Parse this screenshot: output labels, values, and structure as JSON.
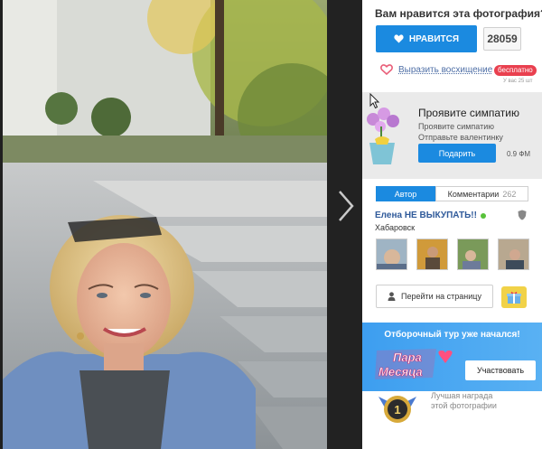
{
  "question": "Вам нравится эта фотография?",
  "like": {
    "label": "НРАВИТСЯ",
    "count": "28059"
  },
  "admire": {
    "link": "Выразить восхищение",
    "badge": "бесплатно",
    "note": "У вас 25 шт"
  },
  "gift": {
    "title": "Проявите симпатию",
    "line1": "Проявите симпатию",
    "line2": "Отправьте валентинку",
    "button": "Подарить",
    "price": "0.9 ФМ"
  },
  "tabs": {
    "author": "Автор",
    "comments": "Комментарии",
    "comments_count": "262"
  },
  "author": {
    "name": "Елена НЕ ВЫКУПАТЬ!!",
    "city": "Хабаровск"
  },
  "goto_page": "Перейти на страницу",
  "promo": {
    "title": "Отборочный тур уже начался!",
    "logo_line1": "Пара",
    "logo_line2": "Месяца",
    "button": "Участвовать"
  },
  "award": {
    "line1": "Лучшая награда",
    "line2": "этой фотографии",
    "medal": "1"
  },
  "colors": {
    "accent": "#1b8ae0",
    "badge": "#e9404f",
    "online": "#58c23a",
    "promo_bg": "#3d9ef0"
  },
  "icons": [
    "heart-icon",
    "heart-outline-icon",
    "shield-icon",
    "person-icon",
    "gift-icon",
    "chevron-right-icon",
    "cursor-icon",
    "medal-icon"
  ]
}
